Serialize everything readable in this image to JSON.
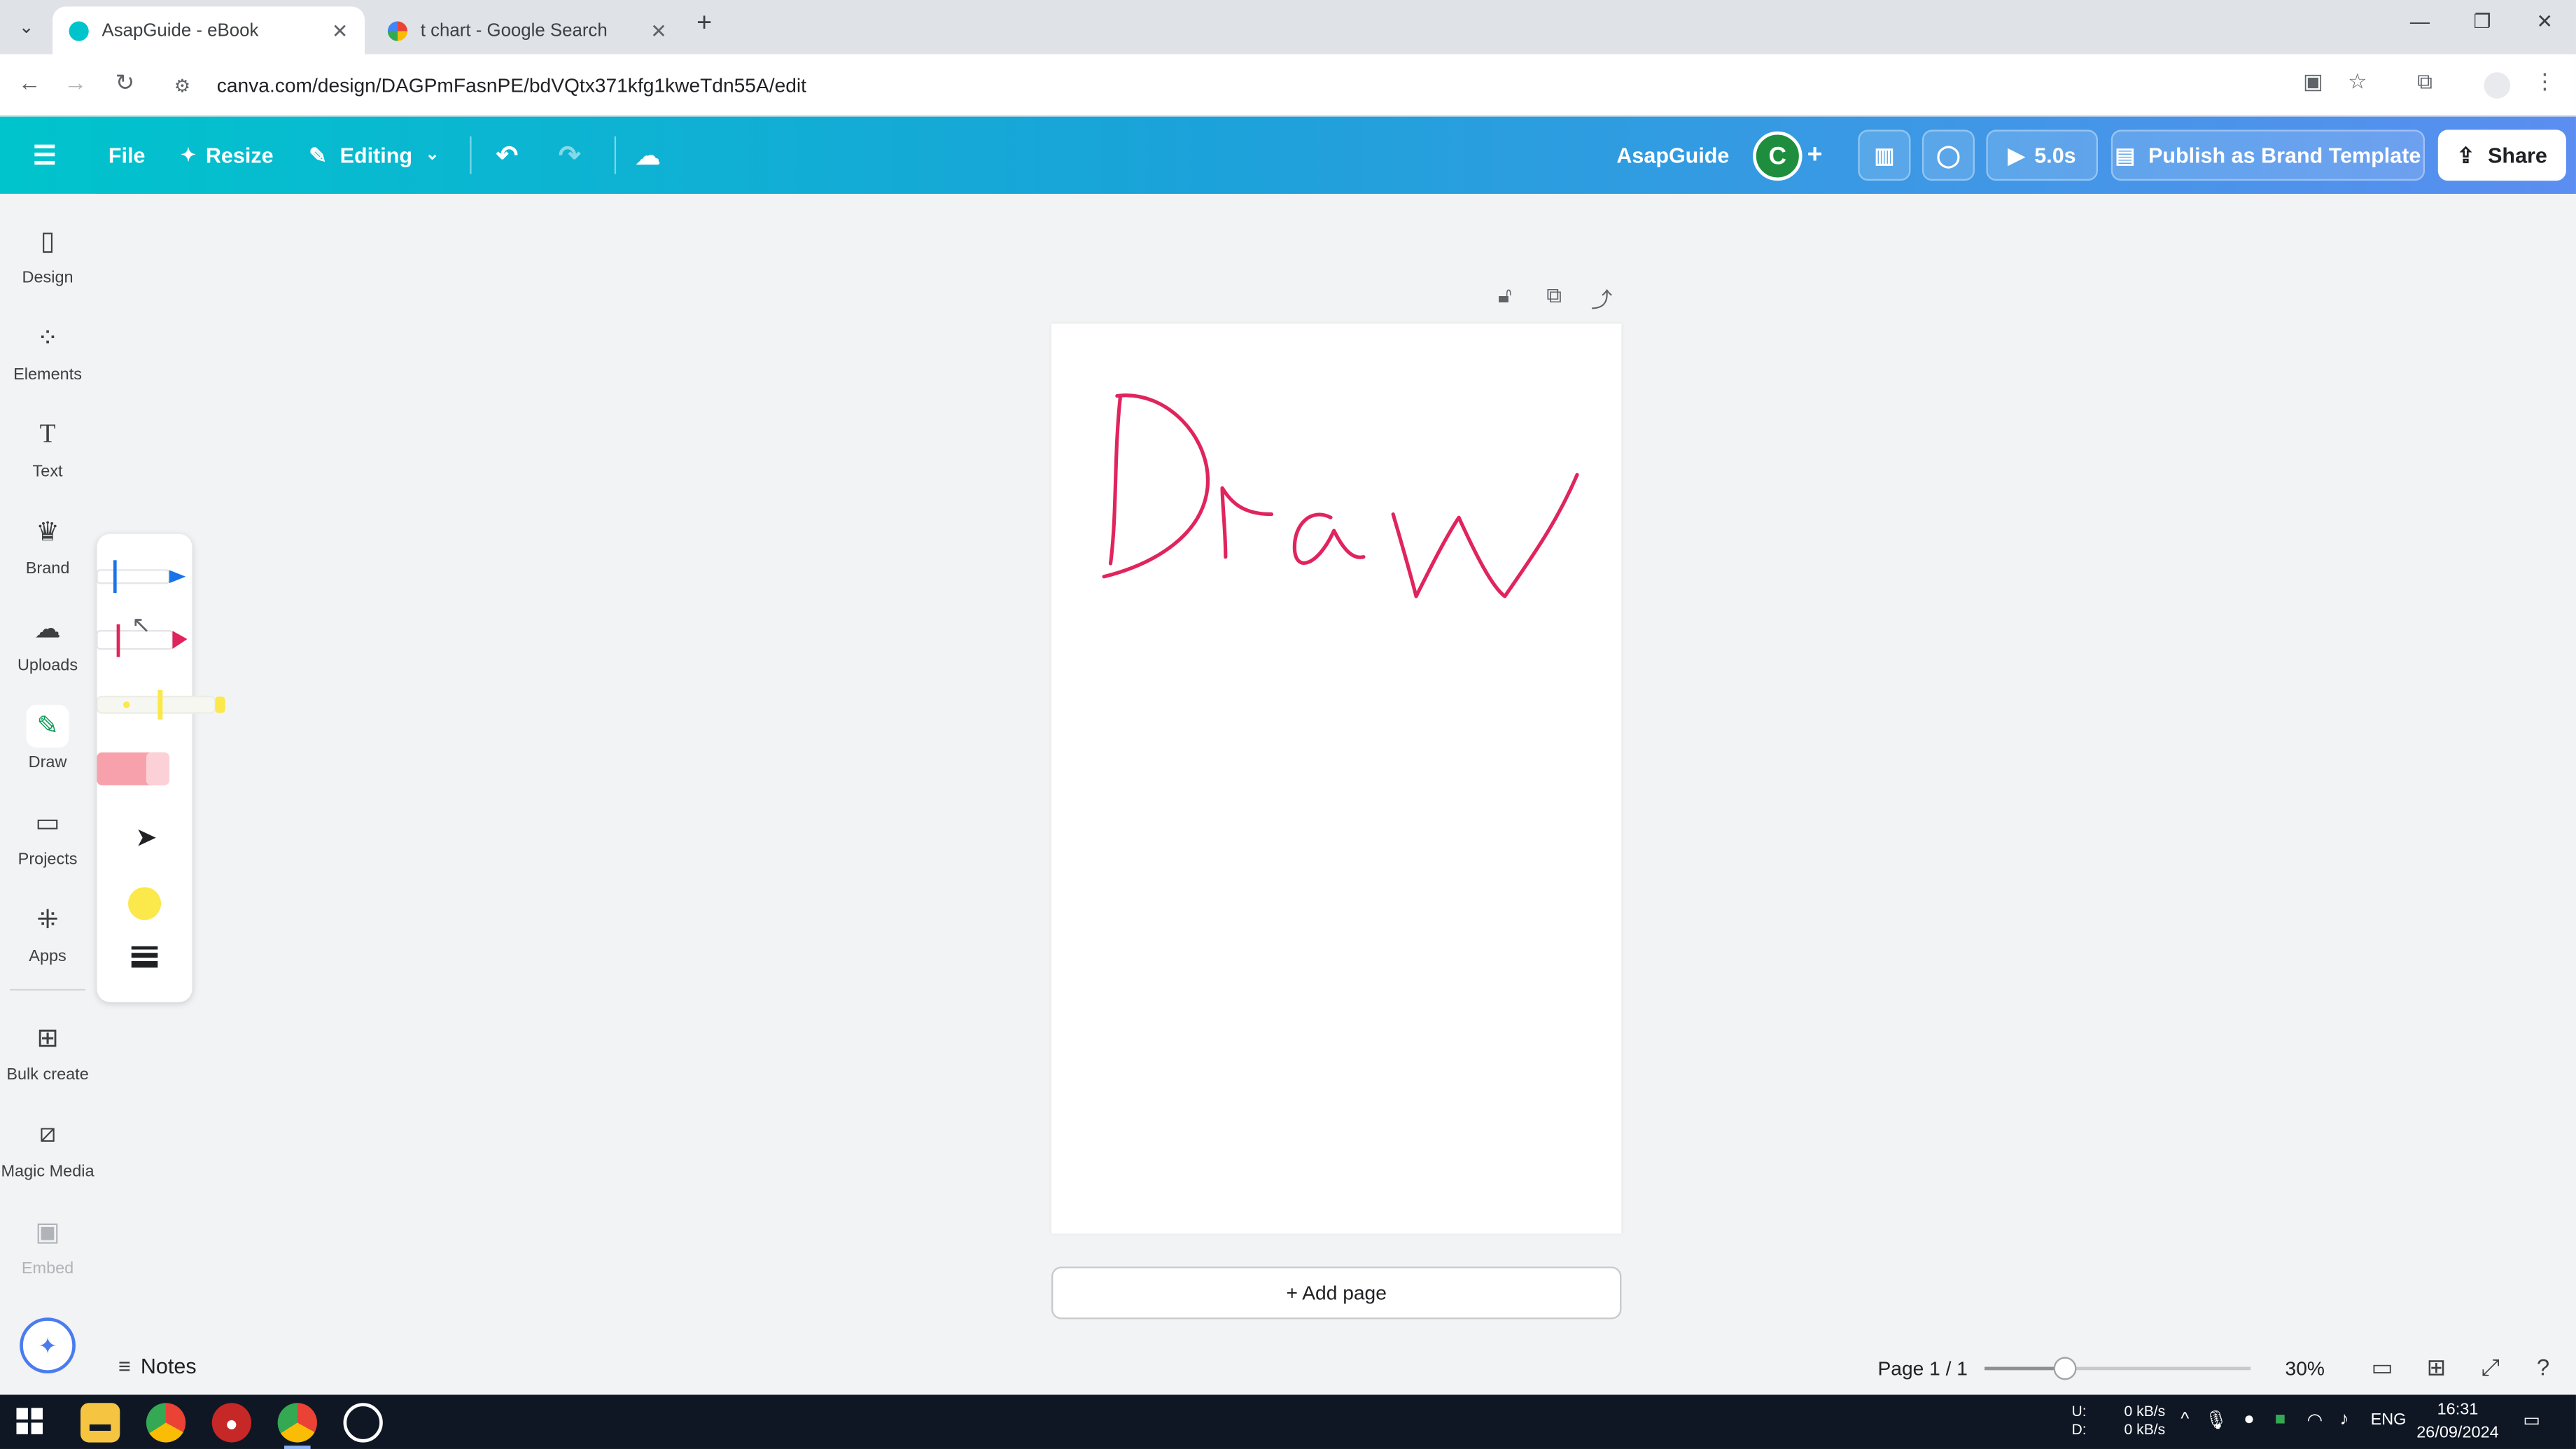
{
  "browser": {
    "tabs": [
      {
        "title": "AsapGuide - eBook",
        "active": true
      },
      {
        "title": "t chart - Google Search",
        "active": false
      }
    ],
    "url": "canva.com/design/DAGPmFasnPE/bdVQtx371kfg1kweTdn55A/edit"
  },
  "header": {
    "file_label": "File",
    "resize_label": "Resize",
    "editing_label": "Editing",
    "doc_title": "AsapGuide",
    "avatar_letter": "C",
    "play_duration": "5.0s",
    "publish_label": "Publish as Brand Template",
    "share_label": "Share",
    "gradient_colors": [
      "#00c4cc",
      "#5b8ef0"
    ]
  },
  "sidebar": {
    "items": [
      {
        "label": "Design",
        "icon": "design-icon"
      },
      {
        "label": "Elements",
        "icon": "elements-icon"
      },
      {
        "label": "Text",
        "icon": "text-icon"
      },
      {
        "label": "Brand",
        "icon": "brand-icon"
      },
      {
        "label": "Uploads",
        "icon": "uploads-icon"
      },
      {
        "label": "Draw",
        "icon": "draw-icon",
        "active": true
      },
      {
        "label": "Projects",
        "icon": "projects-icon"
      },
      {
        "label": "Apps",
        "icon": "apps-icon"
      },
      {
        "label": "Bulk create",
        "icon": "bulk-create-icon"
      },
      {
        "label": "Magic Media",
        "icon": "magic-media-icon"
      },
      {
        "label": "Embed",
        "icon": "embed-icon",
        "disabled": true
      }
    ]
  },
  "draw_panel": {
    "tools": [
      "pen",
      "marker",
      "glow-pen",
      "highlighter",
      "eraser"
    ],
    "pen_color": "#1a73e8",
    "marker_color": "#e0245e",
    "glow_color": "#fbe84a",
    "highlighter_color": "#f7a1ad",
    "selected_color": "#fbe84a"
  },
  "canvas": {
    "drawing_text": "Draw",
    "drawing_color": "#e0245e",
    "add_page_label": "+ Add page"
  },
  "footer": {
    "notes_label": "Notes",
    "page_info": "Page 1 / 1",
    "zoom": "30%",
    "zoom_level": 0.3
  },
  "taskbar": {
    "net_up_label": "U:",
    "net_down_label": "D:",
    "net_up": "0 kB/s",
    "net_down": "0 kB/s",
    "language": "ENG",
    "time": "16:31",
    "date": "26/09/2024"
  }
}
